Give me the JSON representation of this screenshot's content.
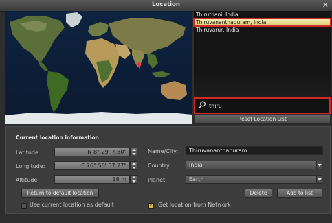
{
  "window": {
    "title": "Location",
    "close_glyph": "✕"
  },
  "locations": [
    {
      "name": "Thiruthani, India",
      "selected": false
    },
    {
      "name": "Thiruvananthapuram, India",
      "selected": true
    },
    {
      "name": "Thiruvarur, India",
      "selected": false
    }
  ],
  "search": {
    "value": "thiru",
    "icon": "search-icon"
  },
  "reset_button": "Reset Location List",
  "info": {
    "section_title": "Current location information",
    "latitude_label": "Latitude:",
    "latitude_value": "N 8° 29' 7.80\"",
    "longitude_label": "Longitude:",
    "longitude_value": "E 76° 56' 57.27\"",
    "altitude_label": "Altitude:",
    "altitude_value": "18 m",
    "name_label": "Name/City:",
    "name_value": "Thiruvananthapuram",
    "country_label": "Country:",
    "country_value": "India",
    "planet_label": "Planet:",
    "planet_value": "Earth"
  },
  "buttons": {
    "return_default": "Return to default location",
    "delete": "Delete",
    "add_to_list": "Add to list"
  },
  "checkboxes": {
    "use_current_default": {
      "label": "Use current location as default",
      "checked": false
    },
    "get_from_network": {
      "label": "Get location from Network",
      "checked": true
    }
  },
  "colors": {
    "highlight": "#d22828",
    "selected_row": "#f1e59a",
    "marker": "#e33b3b"
  }
}
